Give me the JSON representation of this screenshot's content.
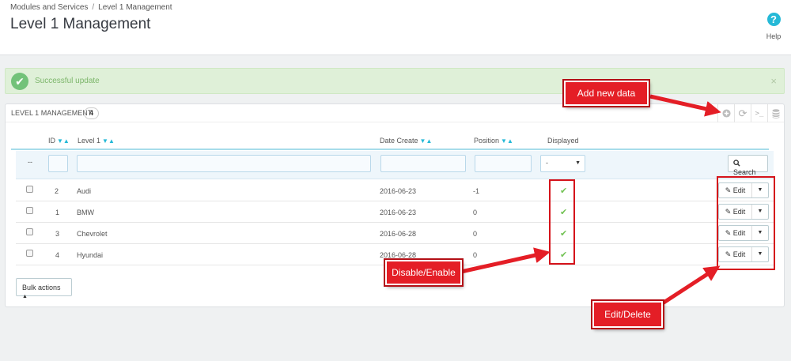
{
  "header": {
    "breadcrumb": [
      "Modules and Services",
      "Level 1 Management"
    ],
    "breadcrumb_sep": "/",
    "title": "Level 1 Management",
    "help_label": "Help",
    "help_icon": "question-circle-icon"
  },
  "alert": {
    "message": "Successful update",
    "close": "×"
  },
  "panel": {
    "title": "LEVEL 1 MANAGEMENT",
    "count": "4",
    "tools": [
      "add-icon",
      "refresh-icon",
      "sql-terminal-icon",
      "database-icon"
    ]
  },
  "table": {
    "columns": {
      "id": "ID",
      "level1": "Level 1",
      "date_create": "Date Create",
      "position": "Position",
      "displayed": "Displayed"
    },
    "filter": {
      "row_marker": "--",
      "displayed_value": "-",
      "search_label": "Search"
    },
    "rows": [
      {
        "id": "2",
        "name": "Audi",
        "date": "2016-06-23",
        "position": "-1"
      },
      {
        "id": "1",
        "name": "BMW",
        "date": "2016-06-23",
        "position": "0"
      },
      {
        "id": "3",
        "name": "Chevrolet",
        "date": "2016-06-28",
        "position": "0"
      },
      {
        "id": "4",
        "name": "Hyundai",
        "date": "2016-06-28",
        "position": "0"
      }
    ],
    "edit_label": "Edit"
  },
  "bulk_actions_label": "Bulk actions",
  "annotations": {
    "add_new": "Add new data",
    "toggle": "Disable/Enable",
    "edit_delete": "Edit/Delete"
  },
  "colors": {
    "accent": "#25b9d7",
    "success": "#72c279",
    "annotation_red": "#e41e26"
  }
}
